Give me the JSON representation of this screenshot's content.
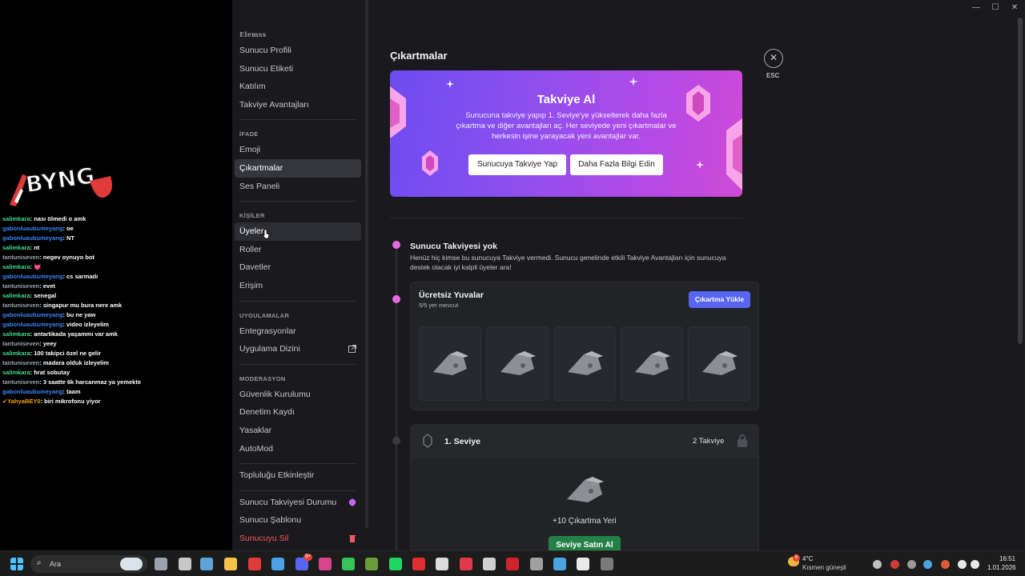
{
  "window": {
    "minimize": "—",
    "maximize": "☐",
    "close": "✕"
  },
  "overlay": {
    "logo_text": "BYNG",
    "chat": [
      {
        "user": "salimkara",
        "msg": "nası ölmedi o amk",
        "color": "#3fdc8b"
      },
      {
        "user": "gabonluaubumeyang",
        "msg": "oe",
        "color": "#3b82f6"
      },
      {
        "user": "gabonluaubumeyang",
        "msg": "NT",
        "color": "#3b82f6"
      },
      {
        "user": "salimkara",
        "msg": "nt",
        "color": "#3fdc8b"
      },
      {
        "user": "tantuniseven",
        "msg": "negev oynuyo bot",
        "color": "#9ca3af"
      },
      {
        "user": "salimkara",
        "msg": "💓",
        "color": "#3fdc8b"
      },
      {
        "user": "gabonluaubumeyang",
        "msg": "cs sarmadı",
        "color": "#3b82f6"
      },
      {
        "user": "tantuniseven",
        "msg": "evet",
        "color": "#9ca3af"
      },
      {
        "user": "salimkara",
        "msg": "senegal",
        "color": "#3fdc8b"
      },
      {
        "user": "tantuniseven",
        "msg": "singapur mu bura nere amk",
        "color": "#9ca3af"
      },
      {
        "user": "gabonluaubumeyang",
        "msg": "bu ne yaw",
        "color": "#3b82f6"
      },
      {
        "user": "gabonluaubumeyang",
        "msg": "video izleyelim",
        "color": "#3b82f6"
      },
      {
        "user": "salimkara",
        "msg": "antartikada yaşammı var amk",
        "color": "#3fdc8b"
      },
      {
        "user": "tantuniseven",
        "msg": "yeey",
        "color": "#9ca3af"
      },
      {
        "user": "salimkara",
        "msg": "100 takipci özel ne gelir",
        "color": "#3fdc8b"
      },
      {
        "user": "tantuniseven",
        "msg": "madara olduk izleyelim",
        "color": "#9ca3af"
      },
      {
        "user": "salimkara",
        "msg": "fırat sobutay",
        "color": "#3fdc8b"
      },
      {
        "user": "tantuniseven",
        "msg": "3 saatte 6k harcanmaz ya yemekte",
        "color": "#9ca3af"
      },
      {
        "user": "gabonluaubumeyang",
        "msg": "taam",
        "color": "#3b82f6"
      },
      {
        "user": "✔YahyaBEY0",
        "msg": "biri mikrofonu yiyor",
        "color": "#f59e0b"
      }
    ]
  },
  "sidebar": {
    "top_label": "Elemss",
    "groups": [
      {
        "header": "",
        "items": [
          "Sunucu Profili",
          "Sunucu Etiketi",
          "Katılım",
          "Takviye Avantajları"
        ]
      },
      {
        "header": "İFADE",
        "items": [
          "Emoji",
          "Çıkartmalar",
          "Ses Paneli"
        ]
      },
      {
        "header": "KİŞİLER",
        "items": [
          "Üyeler",
          "Roller",
          "Davetler",
          "Erişim"
        ]
      },
      {
        "header": "UYGULAMALAR",
        "items": [
          "Entegrasyonlar",
          "Uygulama Dizini"
        ]
      },
      {
        "header": "MODERASYON",
        "items": [
          "Güvenlik Kurulumu",
          "Denetim Kaydı",
          "Yasaklar",
          "AutoMod"
        ]
      },
      {
        "header": "",
        "items": [
          "Topluluğu Etkinleştir"
        ]
      },
      {
        "header": "",
        "items": [
          "Sunucu Takviyesi Durumu",
          "Sunucu Şablonu",
          "Sunucuyu Sil"
        ]
      }
    ]
  },
  "main": {
    "title": "Çıkartmalar",
    "esc": "ESC",
    "banner": {
      "title": "Takviye Al",
      "text": "Sunucuna takviye yapıp 1. Seviye'ye yükselterek daha fazla çıkartma ve diğer avantajları aç. Her seviyede yeni çıkartmalar ve herkesin işine yarayacak yeni avantajlar var.",
      "btn1": "Sunucuya Takviye Yap",
      "btn2": "Daha Fazla Bilgi Edin"
    },
    "no_boost": {
      "title": "Sunucu Takviyesi yok",
      "desc": "Henüz hiç kimse bu sunucuya Takviye vermedi. Sunucu genelinde etkili Takviye Avantajları için sunucuya destek olacak iyi kalpli üyeler ara!"
    },
    "free_slots": {
      "title": "Ücretsiz Yuvalar",
      "sub": "5/5 yer mevcut",
      "upload": "Çıkartma Yükle"
    },
    "level1": {
      "title": "1. Seviye",
      "boosts": "2 Takviye",
      "reward": "+10 Çıkartma Yeri",
      "buy": "Seviye Satın Al"
    }
  },
  "taskbar": {
    "search_placeholder": "Ara",
    "weather_temp": "4°C",
    "weather_text": "Kısmen güneşli",
    "time": "16:51",
    "date": "1.01.2026",
    "discord_badge": "9+",
    "weather_badge": "6"
  }
}
